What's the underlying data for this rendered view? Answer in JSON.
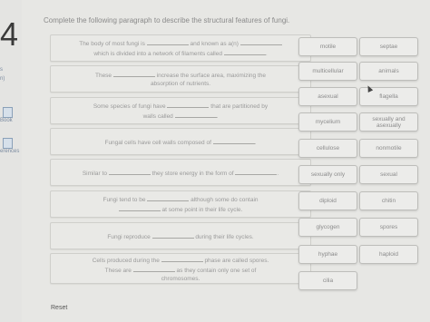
{
  "question_number": "4",
  "instructions": "Complete the following paragraph to describe the structural features of fungi.",
  "sidebar": {
    "links": [
      "s",
      "n)",
      "Book",
      "erences"
    ]
  },
  "sentences": [
    {
      "part1": "The body of most fungi is",
      "part2": "and known as a(n)",
      "part3": "which is divided into a network of filaments called",
      "part4": "."
    },
    {
      "part1": "These",
      "part2": "increase the surface area, maximizing the",
      "part3": "absorption of nutrients."
    },
    {
      "part1": "Some species of fungi have",
      "part2": "that are partitioned by",
      "part3": "walls called",
      "part4": "."
    },
    {
      "part1": "Fungal cells have cell walls composed of",
      "part2": "."
    },
    {
      "part1": "Similar to",
      "part2": "they store energy in the form of",
      "part3": "."
    },
    {
      "part1": "Fungi tend to be",
      "part2": "although some do contain",
      "part3": "at some point in their life cycle."
    },
    {
      "part1": "Fungi reproduce",
      "part2": "during their life cycles."
    },
    {
      "part1": "Cells produced during the",
      "part2": "phase are called spores.",
      "part3": "These are",
      "part4": "as they contain only one set of",
      "part5": "chromosomes."
    }
  ],
  "word_bank": [
    "motile",
    "septae",
    "multicellular",
    "animals",
    "asexual",
    "flagella",
    "mycelium",
    "sexually and asexually",
    "cellulose",
    "nonmotile",
    "sexually only",
    "sexual",
    "diploid",
    "chitin",
    "glycogen",
    "spores",
    "hyphae",
    "haploid",
    "cilia"
  ],
  "reset_label": "Reset"
}
